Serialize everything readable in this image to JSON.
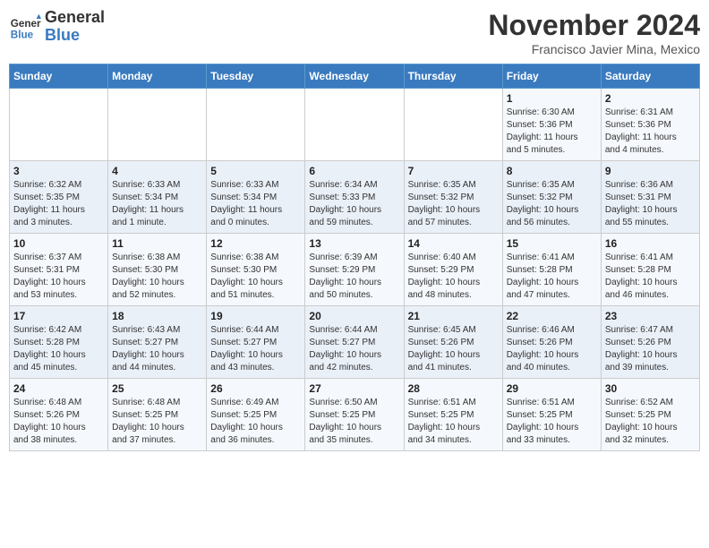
{
  "header": {
    "logo_line1": "General",
    "logo_line2": "Blue",
    "month_year": "November 2024",
    "location": "Francisco Javier Mina, Mexico"
  },
  "days_of_week": [
    "Sunday",
    "Monday",
    "Tuesday",
    "Wednesday",
    "Thursday",
    "Friday",
    "Saturday"
  ],
  "weeks": [
    [
      {
        "day": "",
        "info": ""
      },
      {
        "day": "",
        "info": ""
      },
      {
        "day": "",
        "info": ""
      },
      {
        "day": "",
        "info": ""
      },
      {
        "day": "",
        "info": ""
      },
      {
        "day": "1",
        "info": "Sunrise: 6:30 AM\nSunset: 5:36 PM\nDaylight: 11 hours\nand 5 minutes."
      },
      {
        "day": "2",
        "info": "Sunrise: 6:31 AM\nSunset: 5:36 PM\nDaylight: 11 hours\nand 4 minutes."
      }
    ],
    [
      {
        "day": "3",
        "info": "Sunrise: 6:32 AM\nSunset: 5:35 PM\nDaylight: 11 hours\nand 3 minutes."
      },
      {
        "day": "4",
        "info": "Sunrise: 6:33 AM\nSunset: 5:34 PM\nDaylight: 11 hours\nand 1 minute."
      },
      {
        "day": "5",
        "info": "Sunrise: 6:33 AM\nSunset: 5:34 PM\nDaylight: 11 hours\nand 0 minutes."
      },
      {
        "day": "6",
        "info": "Sunrise: 6:34 AM\nSunset: 5:33 PM\nDaylight: 10 hours\nand 59 minutes."
      },
      {
        "day": "7",
        "info": "Sunrise: 6:35 AM\nSunset: 5:32 PM\nDaylight: 10 hours\nand 57 minutes."
      },
      {
        "day": "8",
        "info": "Sunrise: 6:35 AM\nSunset: 5:32 PM\nDaylight: 10 hours\nand 56 minutes."
      },
      {
        "day": "9",
        "info": "Sunrise: 6:36 AM\nSunset: 5:31 PM\nDaylight: 10 hours\nand 55 minutes."
      }
    ],
    [
      {
        "day": "10",
        "info": "Sunrise: 6:37 AM\nSunset: 5:31 PM\nDaylight: 10 hours\nand 53 minutes."
      },
      {
        "day": "11",
        "info": "Sunrise: 6:38 AM\nSunset: 5:30 PM\nDaylight: 10 hours\nand 52 minutes."
      },
      {
        "day": "12",
        "info": "Sunrise: 6:38 AM\nSunset: 5:30 PM\nDaylight: 10 hours\nand 51 minutes."
      },
      {
        "day": "13",
        "info": "Sunrise: 6:39 AM\nSunset: 5:29 PM\nDaylight: 10 hours\nand 50 minutes."
      },
      {
        "day": "14",
        "info": "Sunrise: 6:40 AM\nSunset: 5:29 PM\nDaylight: 10 hours\nand 48 minutes."
      },
      {
        "day": "15",
        "info": "Sunrise: 6:41 AM\nSunset: 5:28 PM\nDaylight: 10 hours\nand 47 minutes."
      },
      {
        "day": "16",
        "info": "Sunrise: 6:41 AM\nSunset: 5:28 PM\nDaylight: 10 hours\nand 46 minutes."
      }
    ],
    [
      {
        "day": "17",
        "info": "Sunrise: 6:42 AM\nSunset: 5:28 PM\nDaylight: 10 hours\nand 45 minutes."
      },
      {
        "day": "18",
        "info": "Sunrise: 6:43 AM\nSunset: 5:27 PM\nDaylight: 10 hours\nand 44 minutes."
      },
      {
        "day": "19",
        "info": "Sunrise: 6:44 AM\nSunset: 5:27 PM\nDaylight: 10 hours\nand 43 minutes."
      },
      {
        "day": "20",
        "info": "Sunrise: 6:44 AM\nSunset: 5:27 PM\nDaylight: 10 hours\nand 42 minutes."
      },
      {
        "day": "21",
        "info": "Sunrise: 6:45 AM\nSunset: 5:26 PM\nDaylight: 10 hours\nand 41 minutes."
      },
      {
        "day": "22",
        "info": "Sunrise: 6:46 AM\nSunset: 5:26 PM\nDaylight: 10 hours\nand 40 minutes."
      },
      {
        "day": "23",
        "info": "Sunrise: 6:47 AM\nSunset: 5:26 PM\nDaylight: 10 hours\nand 39 minutes."
      }
    ],
    [
      {
        "day": "24",
        "info": "Sunrise: 6:48 AM\nSunset: 5:26 PM\nDaylight: 10 hours\nand 38 minutes."
      },
      {
        "day": "25",
        "info": "Sunrise: 6:48 AM\nSunset: 5:25 PM\nDaylight: 10 hours\nand 37 minutes."
      },
      {
        "day": "26",
        "info": "Sunrise: 6:49 AM\nSunset: 5:25 PM\nDaylight: 10 hours\nand 36 minutes."
      },
      {
        "day": "27",
        "info": "Sunrise: 6:50 AM\nSunset: 5:25 PM\nDaylight: 10 hours\nand 35 minutes."
      },
      {
        "day": "28",
        "info": "Sunrise: 6:51 AM\nSunset: 5:25 PM\nDaylight: 10 hours\nand 34 minutes."
      },
      {
        "day": "29",
        "info": "Sunrise: 6:51 AM\nSunset: 5:25 PM\nDaylight: 10 hours\nand 33 minutes."
      },
      {
        "day": "30",
        "info": "Sunrise: 6:52 AM\nSunset: 5:25 PM\nDaylight: 10 hours\nand 32 minutes."
      }
    ]
  ]
}
